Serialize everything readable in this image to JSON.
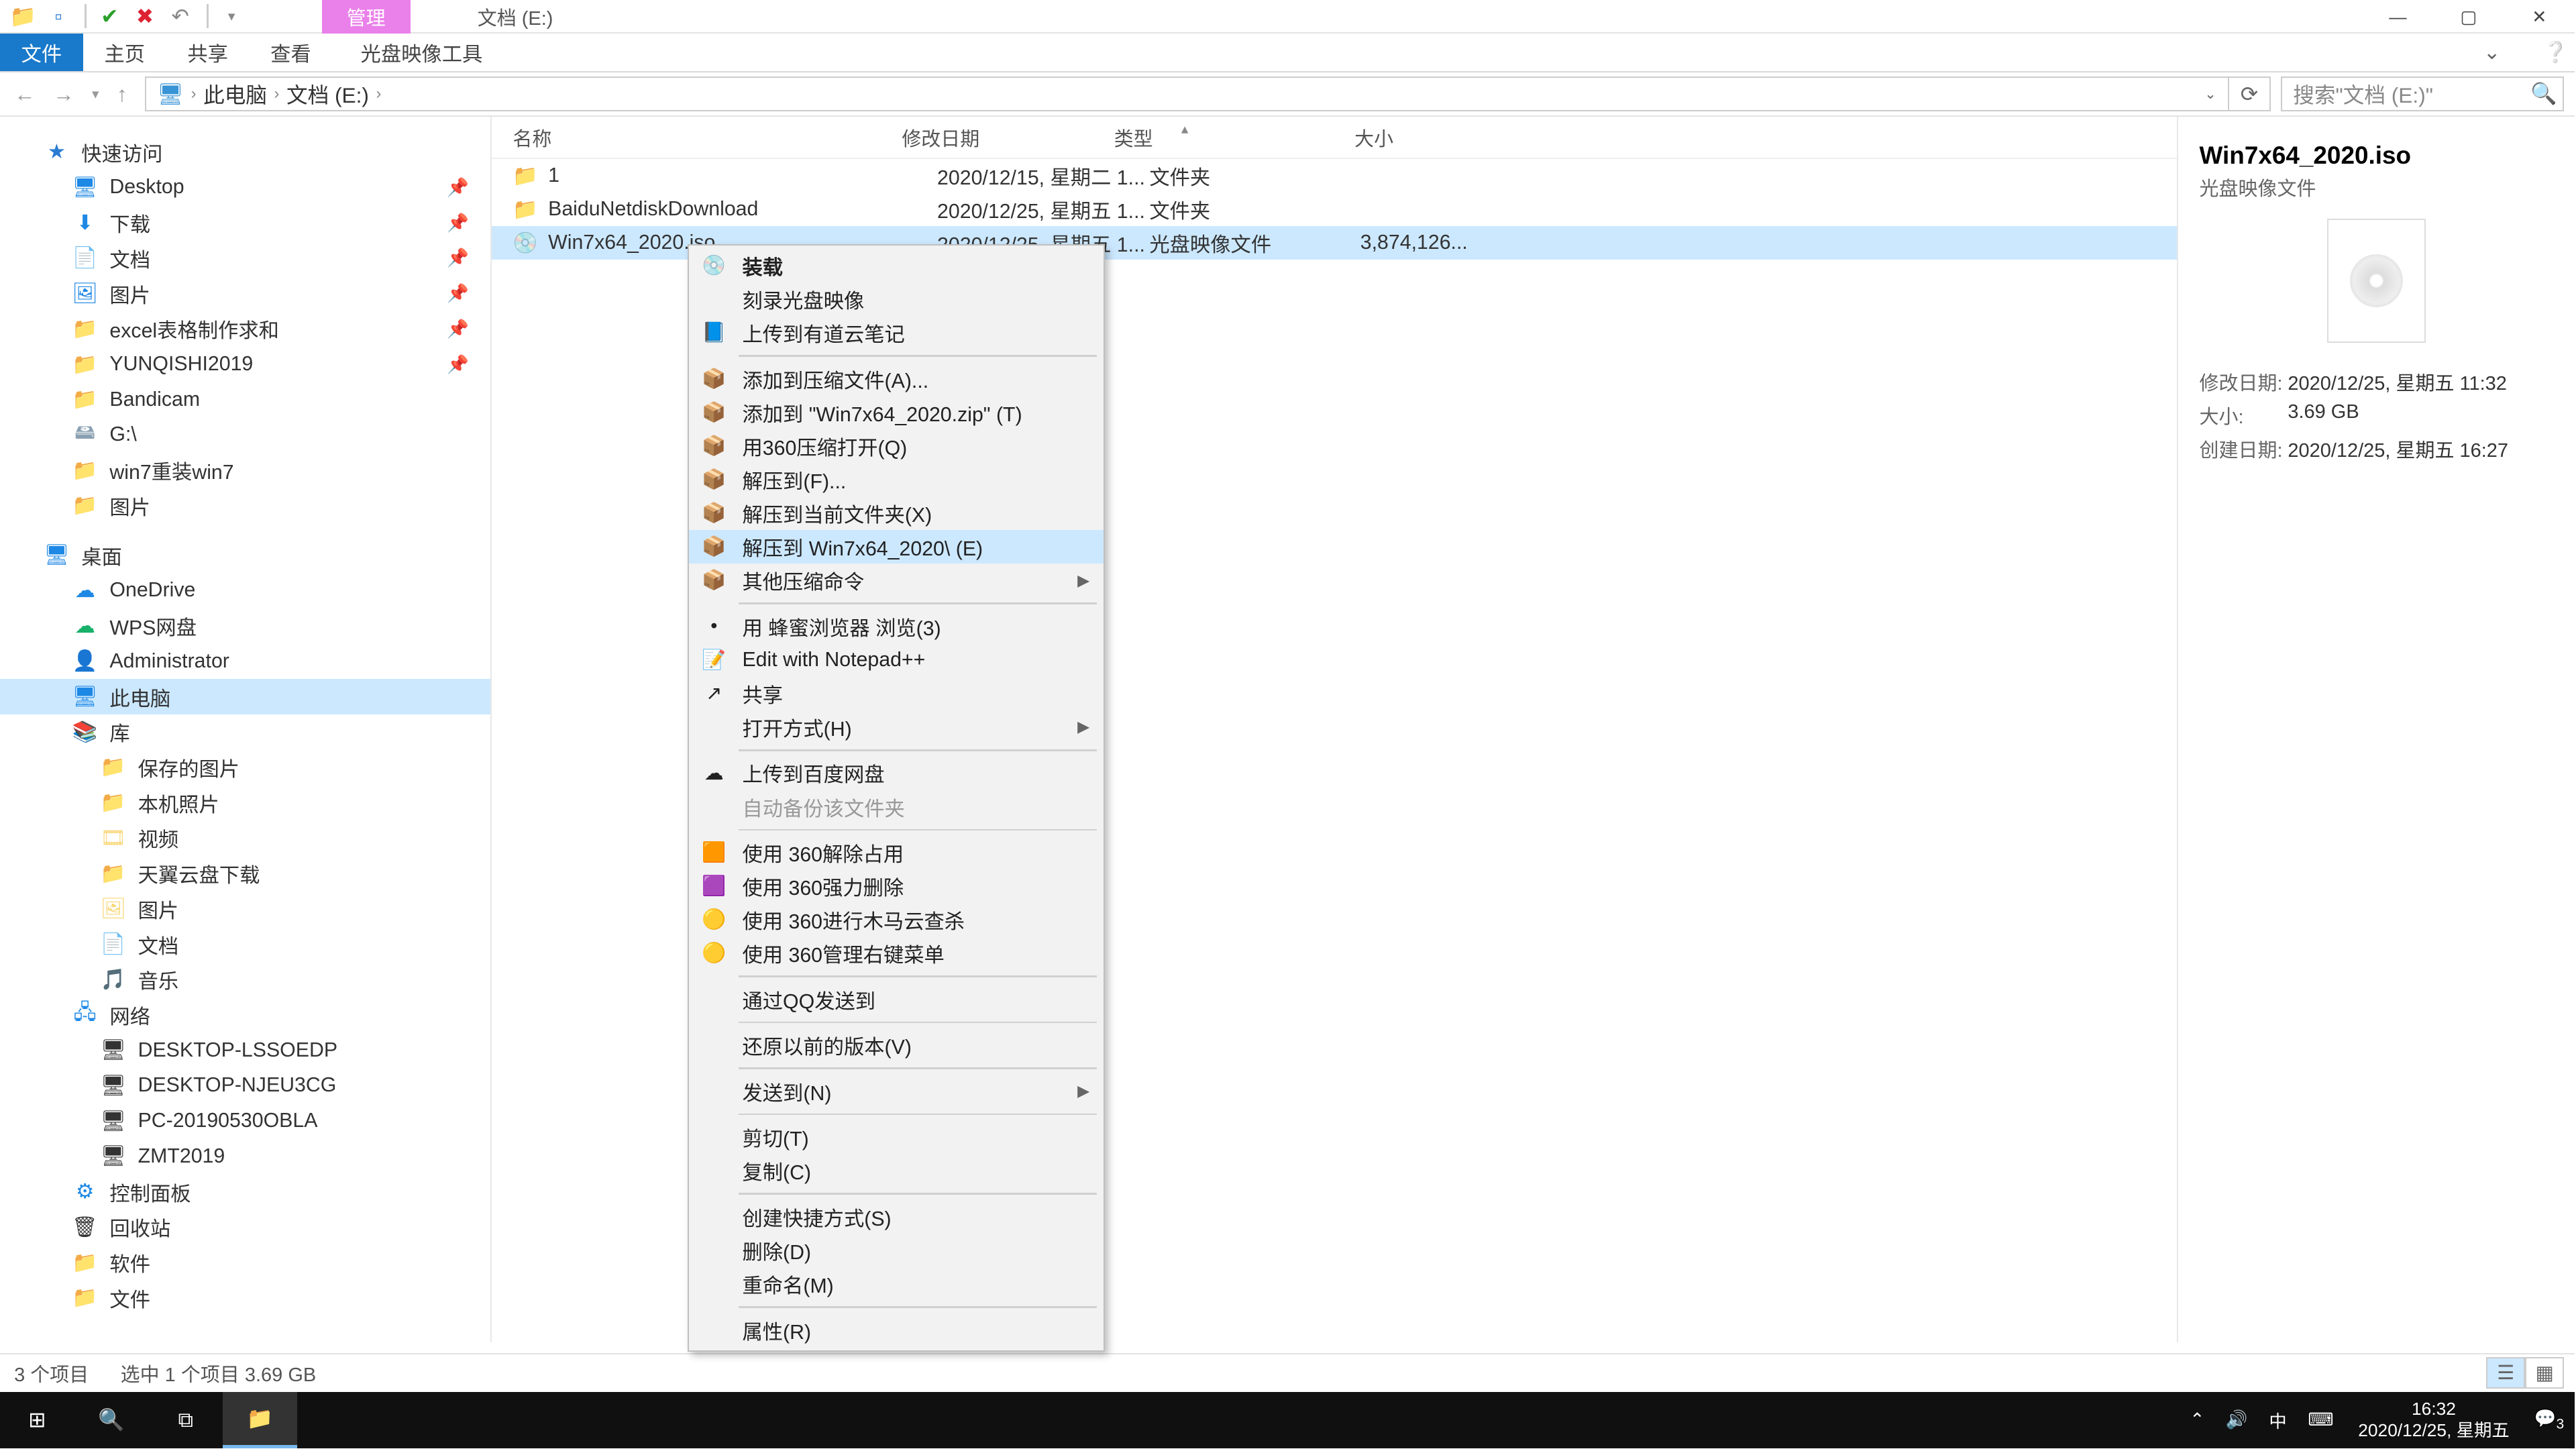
{
  "qat_title_context": "管理",
  "title_path": "文档 (E:)",
  "ribbon": {
    "file": "文件",
    "home": "主页",
    "share": "共享",
    "view": "查看",
    "isotools": "光盘映像工具"
  },
  "addr": {
    "pc": "此电脑",
    "folder": "文档 (E:)"
  },
  "search_placeholder": "搜索\"文档 (E:)\"",
  "cols": {
    "name": "名称",
    "date": "修改日期",
    "type": "类型",
    "size": "大小"
  },
  "rows": [
    {
      "name": "1",
      "date": "2020/12/15, 星期二 1...",
      "type": "文件夹",
      "size": ""
    },
    {
      "name": "BaiduNetdiskDownload",
      "date": "2020/12/25, 星期五 1...",
      "type": "文件夹",
      "size": ""
    },
    {
      "name": "Win7x64_2020.iso",
      "date": "2020/12/25, 星期五 1...",
      "type": "光盘映像文件",
      "size": "3,874,126..."
    }
  ],
  "nav": {
    "quick": "快速访问",
    "quick_items": [
      "Desktop",
      "下载",
      "文档",
      "图片",
      "excel表格制作求和",
      "YUNQISHI2019",
      "Bandicam",
      "G:\\",
      "win7重装win7",
      "图片"
    ],
    "desktop": "桌面",
    "desktop_items": [
      "OneDrive",
      "WPS网盘",
      "Administrator",
      "此电脑",
      "库"
    ],
    "lib_items": [
      "保存的图片",
      "本机照片",
      "视频",
      "天翼云盘下载",
      "图片",
      "文档",
      "音乐"
    ],
    "network": "网络",
    "net_items": [
      "DESKTOP-LSSOEDP",
      "DESKTOP-NJEU3CG",
      "PC-20190530OBLA",
      "ZMT2019"
    ],
    "cp": "控制面板",
    "bin": "回收站",
    "soft": "软件",
    "files": "文件"
  },
  "preview": {
    "title": "Win7x64_2020.iso",
    "sub": "光盘映像文件",
    "mdate_k": "修改日期:",
    "mdate_v": "2020/12/25, 星期五 11:32",
    "size_k": "大小:",
    "size_v": "3.69 GB",
    "cdate_k": "创建日期:",
    "cdate_v": "2020/12/25, 星期五 16:27"
  },
  "status": {
    "items": "3 个项目",
    "sel": "选中 1 个项目  3.69 GB"
  },
  "ctx": [
    {
      "t": "装载",
      "ico": "💿",
      "bold": true
    },
    {
      "t": "刻录光盘映像"
    },
    {
      "t": "上传到有道云笔记",
      "ico": "📘"
    },
    {
      "sep": true
    },
    {
      "t": "添加到压缩文件(A)...",
      "ico": "📦"
    },
    {
      "t": "添加到 \"Win7x64_2020.zip\" (T)",
      "ico": "📦"
    },
    {
      "t": "用360压缩打开(Q)",
      "ico": "📦"
    },
    {
      "t": "解压到(F)...",
      "ico": "📦"
    },
    {
      "t": "解压到当前文件夹(X)",
      "ico": "📦"
    },
    {
      "t": "解压到 Win7x64_2020\\ (E)",
      "ico": "📦",
      "hover": true
    },
    {
      "t": "其他压缩命令",
      "ico": "📦",
      "arrow": true
    },
    {
      "sep": true
    },
    {
      "t": "用 蜂蜜浏览器 浏览(3)",
      "ico": "•"
    },
    {
      "t": "Edit with Notepad++",
      "ico": "📝"
    },
    {
      "t": "共享",
      "ico": "↗"
    },
    {
      "t": "打开方式(H)",
      "arrow": true
    },
    {
      "sep": true
    },
    {
      "t": "上传到百度网盘",
      "ico": "☁"
    },
    {
      "t": "自动备份该文件夹",
      "dis": true
    },
    {
      "sep": true
    },
    {
      "t": "使用 360解除占用",
      "ico": "🟧"
    },
    {
      "t": "使用 360强力删除",
      "ico": "🟪"
    },
    {
      "t": "使用 360进行木马云查杀",
      "ico": "🟡"
    },
    {
      "t": "使用 360管理右键菜单",
      "ico": "🟡"
    },
    {
      "sep": true
    },
    {
      "t": "通过QQ发送到"
    },
    {
      "sep": true
    },
    {
      "t": "还原以前的版本(V)"
    },
    {
      "sep": true
    },
    {
      "t": "发送到(N)",
      "arrow": true
    },
    {
      "sep": true
    },
    {
      "t": "剪切(T)"
    },
    {
      "t": "复制(C)"
    },
    {
      "sep": true
    },
    {
      "t": "创建快捷方式(S)"
    },
    {
      "t": "删除(D)"
    },
    {
      "t": "重命名(M)"
    },
    {
      "sep": true
    },
    {
      "t": "属性(R)"
    }
  ],
  "tray": {
    "ime": "中",
    "time": "16:32",
    "date": "2020/12/25, 星期五",
    "notif": "3"
  }
}
